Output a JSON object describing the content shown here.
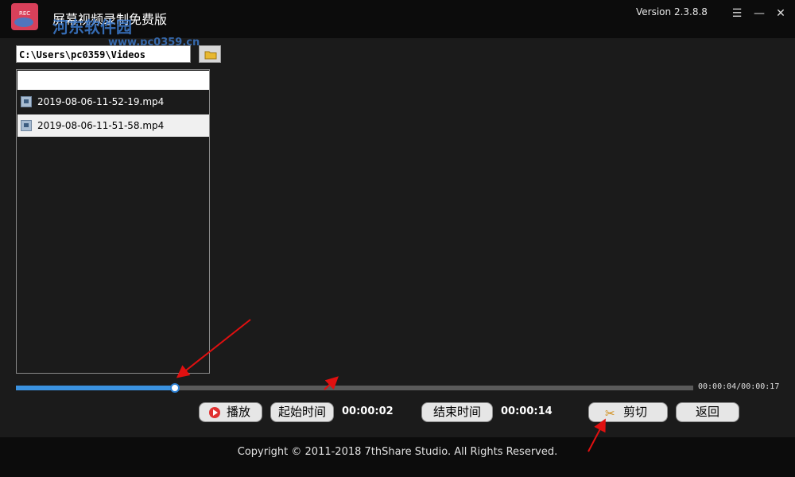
{
  "titlebar": {
    "title": "屏幕视频录制免费版",
    "version": "Version 2.3.8.8",
    "watermark": "河东软件园",
    "watermark_url": "www.pc0359.cn",
    "icon_label": "REC"
  },
  "path": {
    "value": "C:\\Users\\pc0359\\Videos"
  },
  "file_list": {
    "items": [
      {
        "name": "2019-08-06-11-52-19.mp4"
      },
      {
        "name": "2019-08-06-11-51-58.mp4",
        "selected": true
      }
    ]
  },
  "player": {
    "progress_fraction": 0.235,
    "time_readout": "00:00:04/00:00:17"
  },
  "controls": {
    "play_label": "播放",
    "start_label": "起始时间",
    "start_value": "00:00:02",
    "end_label": "结束时间",
    "end_value": "00:00:14",
    "cut_label": "剪切",
    "back_label": "返回"
  },
  "footer": {
    "copyright": "Copyright © 2011-2018 7thShare Studio. All Rights Reserved."
  },
  "colors": {
    "accent": "#3b92e0",
    "annotation_arrow": "#e01010",
    "background": "#1b1b1b"
  }
}
